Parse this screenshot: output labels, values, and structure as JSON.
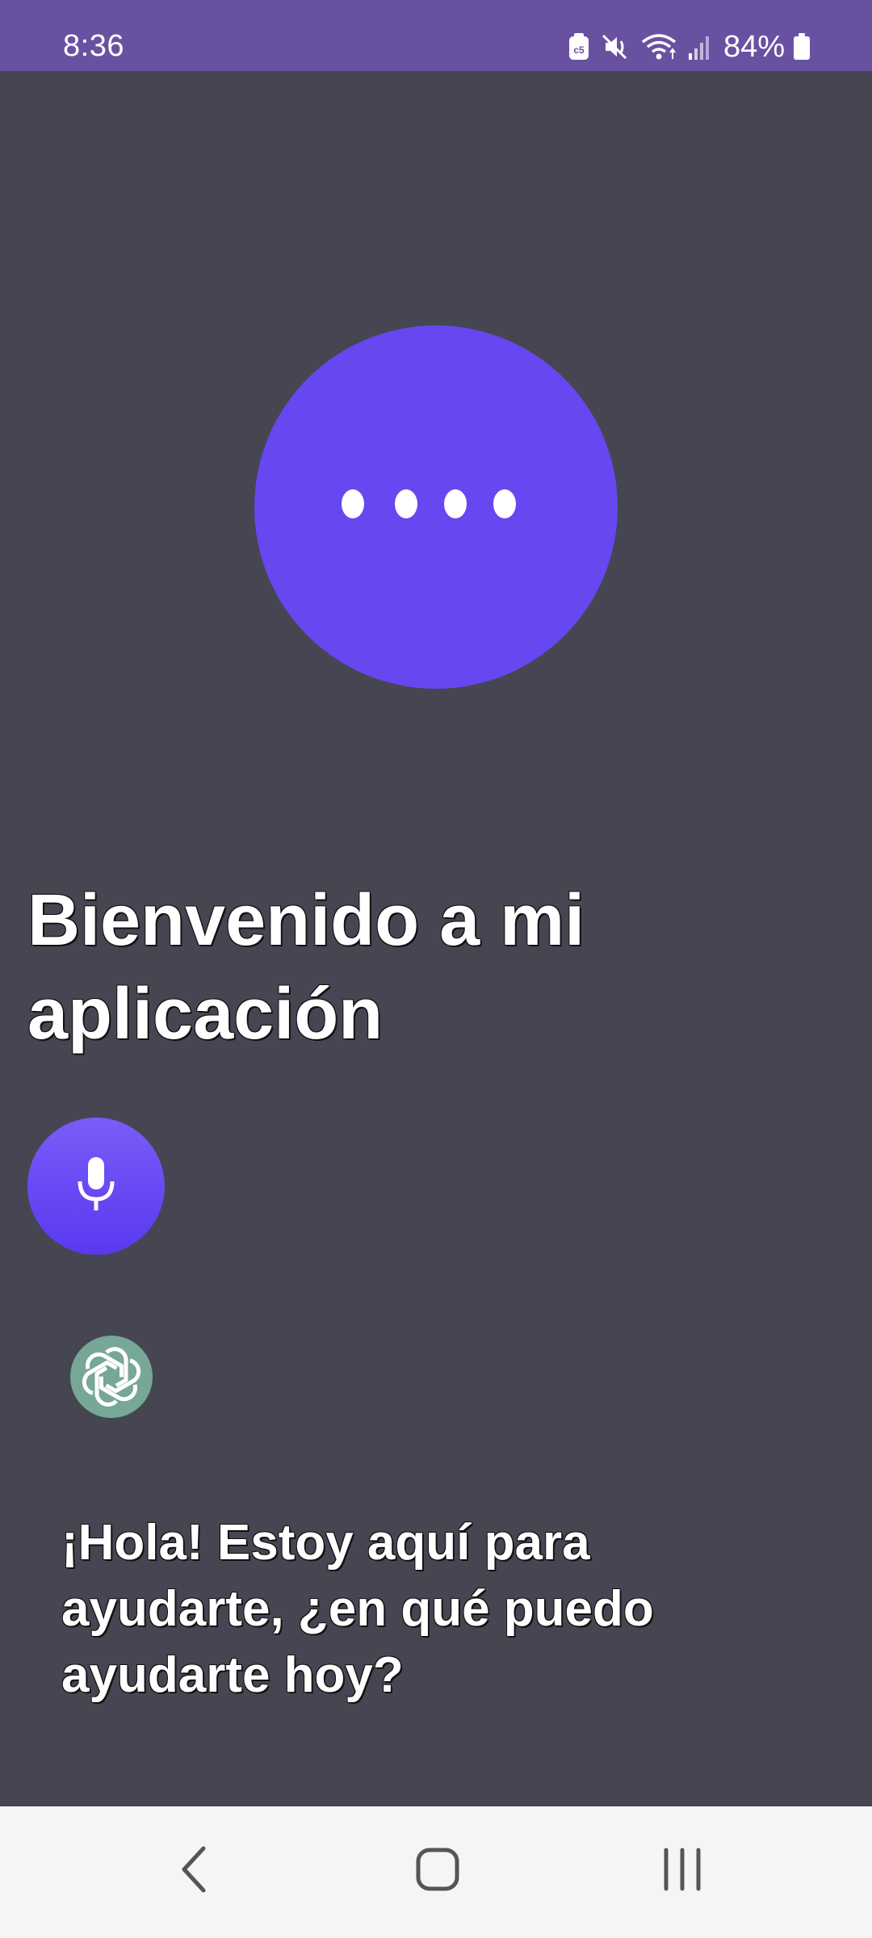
{
  "status_bar": {
    "time": "8:36",
    "battery_percent": "84%",
    "icons": [
      "notification-app-icon",
      "mute-vibrate-icon",
      "wifi-icon",
      "signal-icon",
      "battery-icon"
    ],
    "background_color": "#6951a2"
  },
  "orb": {
    "color": "#6647f0",
    "dots": 4
  },
  "main": {
    "title": "Bienvenido a mi aplicación",
    "mic_icon": "microphone-icon",
    "assistant_icon": "openai-logo-icon",
    "response": "¡Hola! Estoy aquí para ayudarte, ¿en qué puedo ayudarte hoy?"
  },
  "nav": {
    "buttons": [
      "back-icon",
      "home-icon",
      "recents-icon"
    ]
  },
  "colors": {
    "background": "#454651",
    "accent": "#6647f0",
    "logo_bg": "#76a797"
  }
}
